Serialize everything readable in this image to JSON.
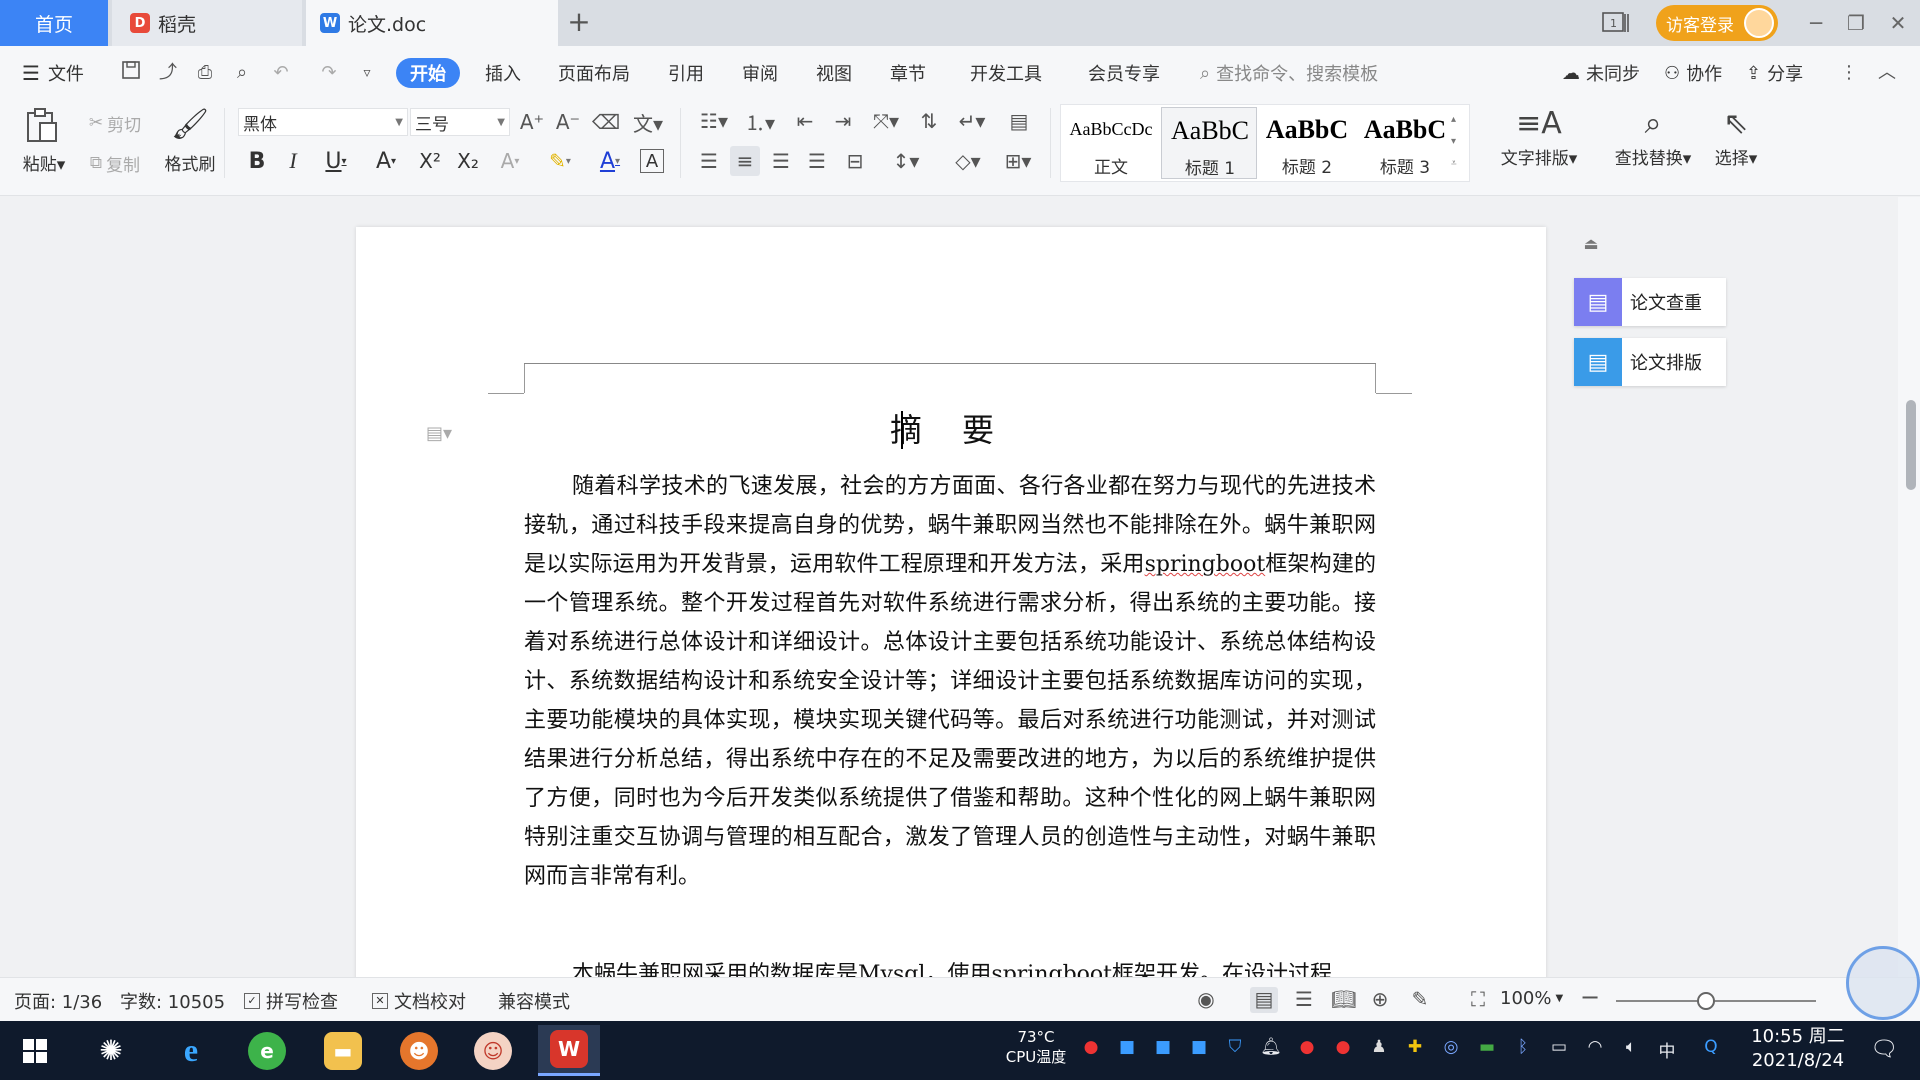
{
  "tabs": {
    "home": "首页",
    "docer": "稻壳",
    "doc": "论文.doc",
    "add": "+"
  },
  "window": {
    "login": "访客登录"
  },
  "menu": {
    "file": "文件",
    "items": [
      "开始",
      "插入",
      "页面布局",
      "引用",
      "审阅",
      "视图",
      "章节",
      "开发工具",
      "会员专享"
    ],
    "search_placeholder": "查找命令、搜索模板",
    "sync": "未同步",
    "collab": "协作",
    "share": "分享"
  },
  "ribbon": {
    "paste": "粘贴",
    "cut": "剪切",
    "copy": "复制",
    "format_painter": "格式刷",
    "font_name": "黑体",
    "font_size": "三号",
    "styles": [
      {
        "sample": "AaBbCcDc",
        "name": "正文"
      },
      {
        "sample": "AaBbC",
        "name": "标题 1"
      },
      {
        "sample": "AaBbC",
        "name": "标题 2"
      },
      {
        "sample": "AaBbC",
        "name": "标题 3"
      }
    ],
    "text_layout": "文字排版",
    "find_replace": "查找替换",
    "select": "选择"
  },
  "document": {
    "title": "摘 要",
    "p1_before": "随着科学技术的飞速发展，社会的方方面面、各行各业都在努力与现代的先进技术接轨，通过科技手段来提高自身的优势，蜗牛兼职网当然也不能排除在外。蜗牛兼职网是以实际运用为开发背景，运用软件工程原理和开发方法，采用",
    "p1_word": "springboot",
    "p1_after": "框架构建的一个管理系统。整个开发过程首先对软件系统进行需求分析，得出系统的主要功能。接着对系统进行总体设计和详细设计。总体设计主要包括系统功能设计、系统总体结构设计、系统数据结构设计和系统安全设计等；详细设计主要包括系统数据库访问的实现，主要功能模块的具体实现，模块实现关键代码等。最后对系统进行功能测试，并对测试结果进行分析总结，得出系统中存在的不足及需要改进的地方，为以后的系统维护提供了方便，同时也为今后开发类似系统提供了借鉴和帮助。这种个性化的网上蜗牛兼职网特别注重交互协调与管理的相互配合，激发了管理人员的创造性与主动性，对蜗牛兼职网而言非常有利。",
    "p2_a": "本蜗牛兼职网采用的数据库是",
    "p2_mysql": "Mysql",
    "p2_b": "，使用",
    "p2_spring": "springboot",
    "p2_c": "框架开发。在设计过程"
  },
  "side_panel": {
    "check": "论文查重",
    "layout": "论文排版"
  },
  "status": {
    "page": "页面: 1/36",
    "words": "字数: 10505",
    "spell": "拼写检查",
    "proof": "文档校对",
    "compat": "兼容模式",
    "zoom": "100%",
    "zoom_level": 0.45
  },
  "taskbar": {
    "cpu_temp": "73°C",
    "cpu_label": "CPU温度",
    "ime": "中",
    "time": "10:55 周二",
    "date": "2021/8/24"
  },
  "colors": {
    "accent": "#3c84f5",
    "login": "#f0a21b",
    "check_icon": "#7b7ef0",
    "layout_icon": "#3a9be8"
  }
}
